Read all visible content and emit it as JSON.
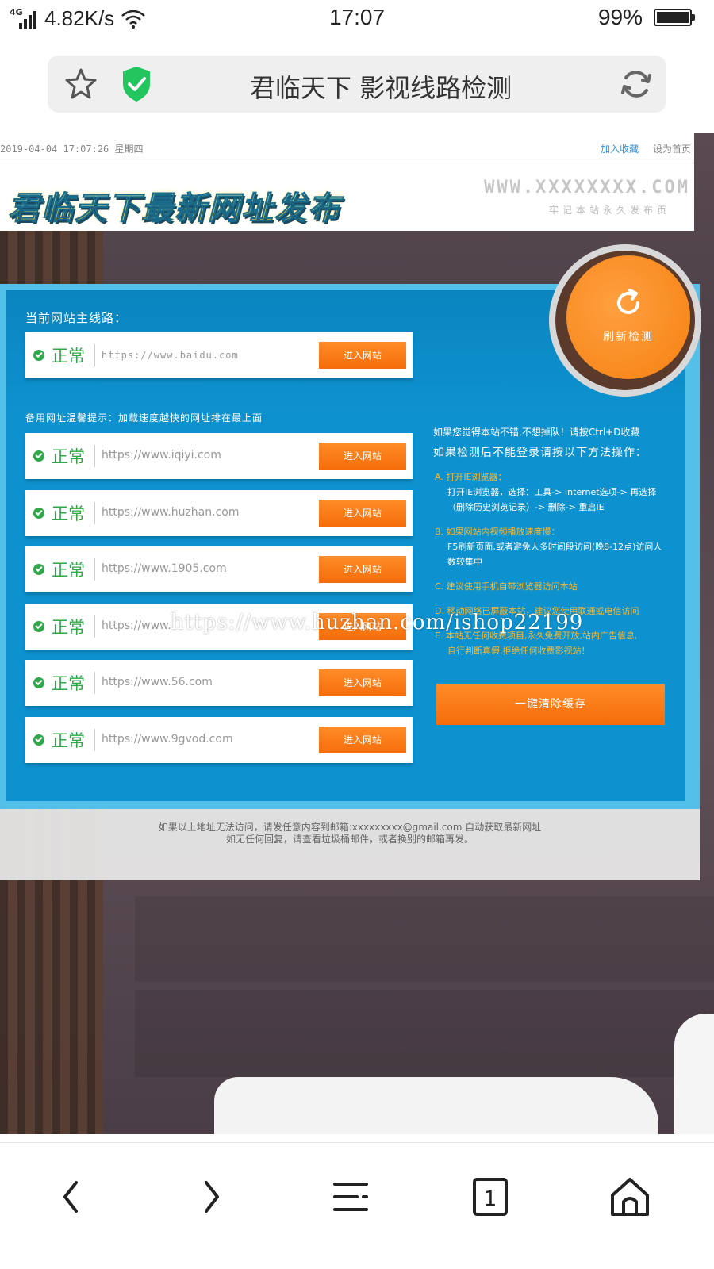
{
  "status_bar": {
    "network": "4G",
    "speed": "4.82K/s",
    "time": "17:07",
    "battery": "99%",
    "battery_level": 0.99
  },
  "browser": {
    "page_title": "君临天下 影视线路检测",
    "icons": [
      "star-icon",
      "shield-check-icon",
      "refresh-icon"
    ],
    "nav_icons": [
      "back-icon",
      "forward-icon",
      "menu-icon",
      "tabs-icon",
      "home-icon"
    ],
    "tab_count": "1"
  },
  "site": {
    "datetime": "2019-04-04 17:07:26 星期四",
    "links": {
      "favorite": "加入收藏",
      "set_home": "设为首页"
    },
    "logo_text": "君临天下最新网址发布",
    "domain": "WWW.XXXXXXXX.COM",
    "domain_sub": "牢记本站永久发布页",
    "main_route_title": "当前网站主线路：",
    "main_route": {
      "status": "正常",
      "url": "https://www.baidu.com",
      "button": "进入网站"
    },
    "backup_title": "备用网址温馨提示：加载速度越快的网址排在最上面",
    "backup_routes": [
      {
        "status": "正常",
        "url": "https://www.iqiyi.com",
        "button": "进入网站"
      },
      {
        "status": "正常",
        "url": "https://www.huzhan.com",
        "button": "进入网站"
      },
      {
        "status": "正常",
        "url": "https://www.1905.com",
        "button": "进入网站"
      },
      {
        "status": "正常",
        "url": "https://www.",
        "button": "进入网站"
      },
      {
        "status": "正常",
        "url": "https://www.56.com",
        "button": "进入网站"
      },
      {
        "status": "正常",
        "url": "https://www.9gvod.com",
        "button": "进入网站"
      }
    ],
    "refresh_badge": "刷新检测",
    "tip_bookmark": "如果您觉得本站不错,不想掉队！请按Ctrl+D收藏",
    "tip_heading": "如果检测后不能登录请按以下方法操作：",
    "tips": [
      {
        "head": "A. 打开IE浏览器：",
        "body": "打开IE浏览器，选择：工具-> Internet选项-> 再选择（删除历史浏览记录）-> 删除-> 重启IE"
      },
      {
        "head": "B. 如果网站内视频播放速度慢：",
        "body": "F5刷新页面,或者避免人多时间段访问(晚8-12点)访问人数较集中"
      },
      {
        "head": "C. 建议使用手机自带浏览器访问本站",
        "body": ""
      },
      {
        "head": "D. 移动网络已屏蔽本站，建议您使用联通或电信访问",
        "body": ""
      },
      {
        "head": "E. 本站无任何收费项目,永久免费开放,站内广告信息,",
        "body": "自行判断真假,拒绝任何收费影视站！"
      }
    ],
    "clear_cache_button": "一键清除缓存",
    "footer_line1": "如果以上地址无法访问，请发任意内容到邮箱:xxxxxxxxx@gmail.com 自动获取最新网址",
    "footer_line2": "如无任何回复，请查看垃圾桶邮件，或者换别的邮箱再发。",
    "watermark": "https://www.huzhan.com/ishop22199"
  }
}
